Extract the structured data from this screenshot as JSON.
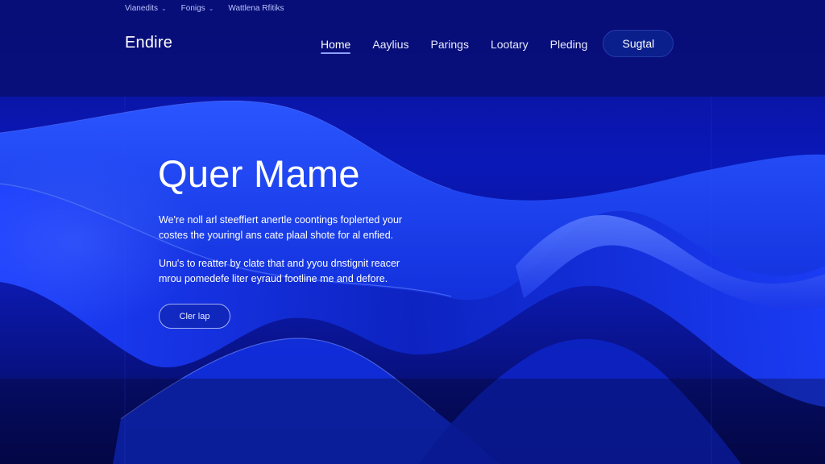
{
  "utility_bar": {
    "items": [
      {
        "label": "Vianedits",
        "has_dropdown": true
      },
      {
        "label": "Fonigs",
        "has_dropdown": true
      },
      {
        "label": "Wattlena Rfitiks",
        "has_dropdown": false
      }
    ]
  },
  "header": {
    "logo": "Endire",
    "nav": [
      {
        "label": "Home",
        "active": true
      },
      {
        "label": "Aaylius",
        "active": false
      },
      {
        "label": "Parings",
        "active": false
      },
      {
        "label": "Lootary",
        "active": false
      },
      {
        "label": "Pleding",
        "active": false
      }
    ],
    "cta_label": "Sugtal"
  },
  "hero": {
    "title": "Quer Mame",
    "paragraph_1": "We're noll arl steeffiert anertle coontings foplerted your costes the youringl ans cate plaal shote for al enfied.",
    "paragraph_2": "Unu's to reatter by clate that and yyou dnstignit reacer mrou pomedefe liter eyraud footline me and defore.",
    "button_label": "Cler lap"
  },
  "colors": {
    "background": "#050a5a",
    "wave_primary": "#1a3cff",
    "wave_light": "#4d6dff",
    "cta_background": "#0b1f8c",
    "text": "#ffffff"
  }
}
